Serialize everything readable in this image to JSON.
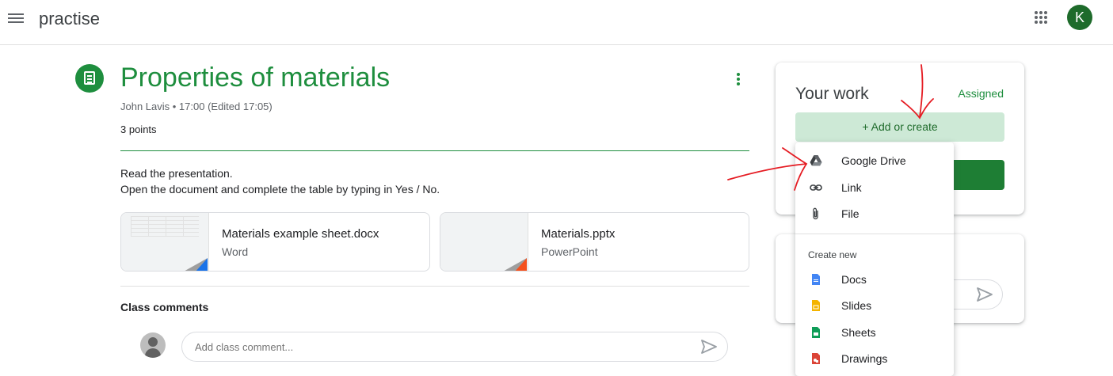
{
  "header": {
    "app_title": "practise",
    "avatar_initial": "K"
  },
  "assignment": {
    "title": "Properties of materials",
    "meta": "John Lavis • 17:00 (Edited 17:05)",
    "points": "3 points",
    "instructions": [
      "Read the presentation.",
      "Open the document and complete the table by typing in Yes / No."
    ]
  },
  "attachments": [
    {
      "name": "Materials example sheet.docx",
      "type": "Word",
      "accent": "#1a73e8"
    },
    {
      "name": "Materials.pptx",
      "type": "PowerPoint",
      "accent": "#f4511e"
    }
  ],
  "comments": {
    "label": "Class comments",
    "placeholder": "Add class comment..."
  },
  "your_work": {
    "title": "Your work",
    "status": "Assigned",
    "add_label": "+  Add or create"
  },
  "menu": {
    "items": [
      "Google Drive",
      "Link",
      "File"
    ],
    "section": "Create new",
    "create_items": [
      "Docs",
      "Slides",
      "Sheets",
      "Drawings"
    ]
  },
  "colors": {
    "accent": "#1e8e3e",
    "annotation": "#e51c23"
  }
}
